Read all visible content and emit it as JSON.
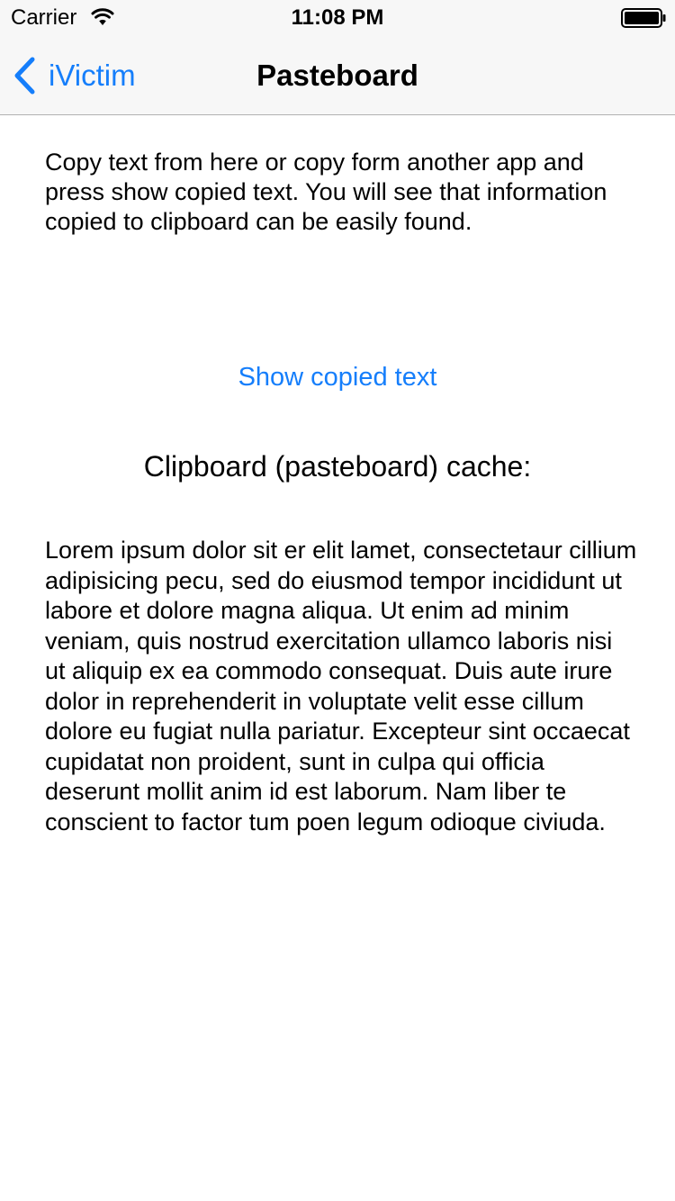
{
  "status_bar": {
    "carrier": "Carrier",
    "time": "11:08 PM",
    "wifi_icon": "wifi-icon",
    "battery_icon": "battery-icon"
  },
  "nav": {
    "back_label": "iVictim",
    "back_icon": "chevron-left-icon",
    "title": "Pasteboard"
  },
  "main": {
    "intro_text": "Copy text from here or copy form another app and press show copied text. You will see that information copied to clipboard can be easily found.",
    "show_button_label": "Show copied text",
    "cache_heading": "Clipboard (pasteboard) cache:",
    "cache_text": "Lorem ipsum dolor sit er elit lamet, consectetaur cillium adipisicing pecu, sed do eiusmod tempor incididunt ut labore et dolore magna aliqua. Ut enim ad minim veniam, quis nostrud exercitation ullamco laboris nisi ut aliquip ex ea commodo consequat. Duis aute irure dolor in reprehenderit in voluptate velit esse cillum dolore eu fugiat nulla pariatur. Excepteur sint occaecat cupidatat non proident, sunt in culpa qui officia deserunt mollit anim id est laborum. Nam liber te conscient to factor tum poen legum odioque civiuda."
  },
  "colors": {
    "tint": "#157efb",
    "nav_background": "#f7f7f7",
    "separator": "#b2b2b2"
  }
}
